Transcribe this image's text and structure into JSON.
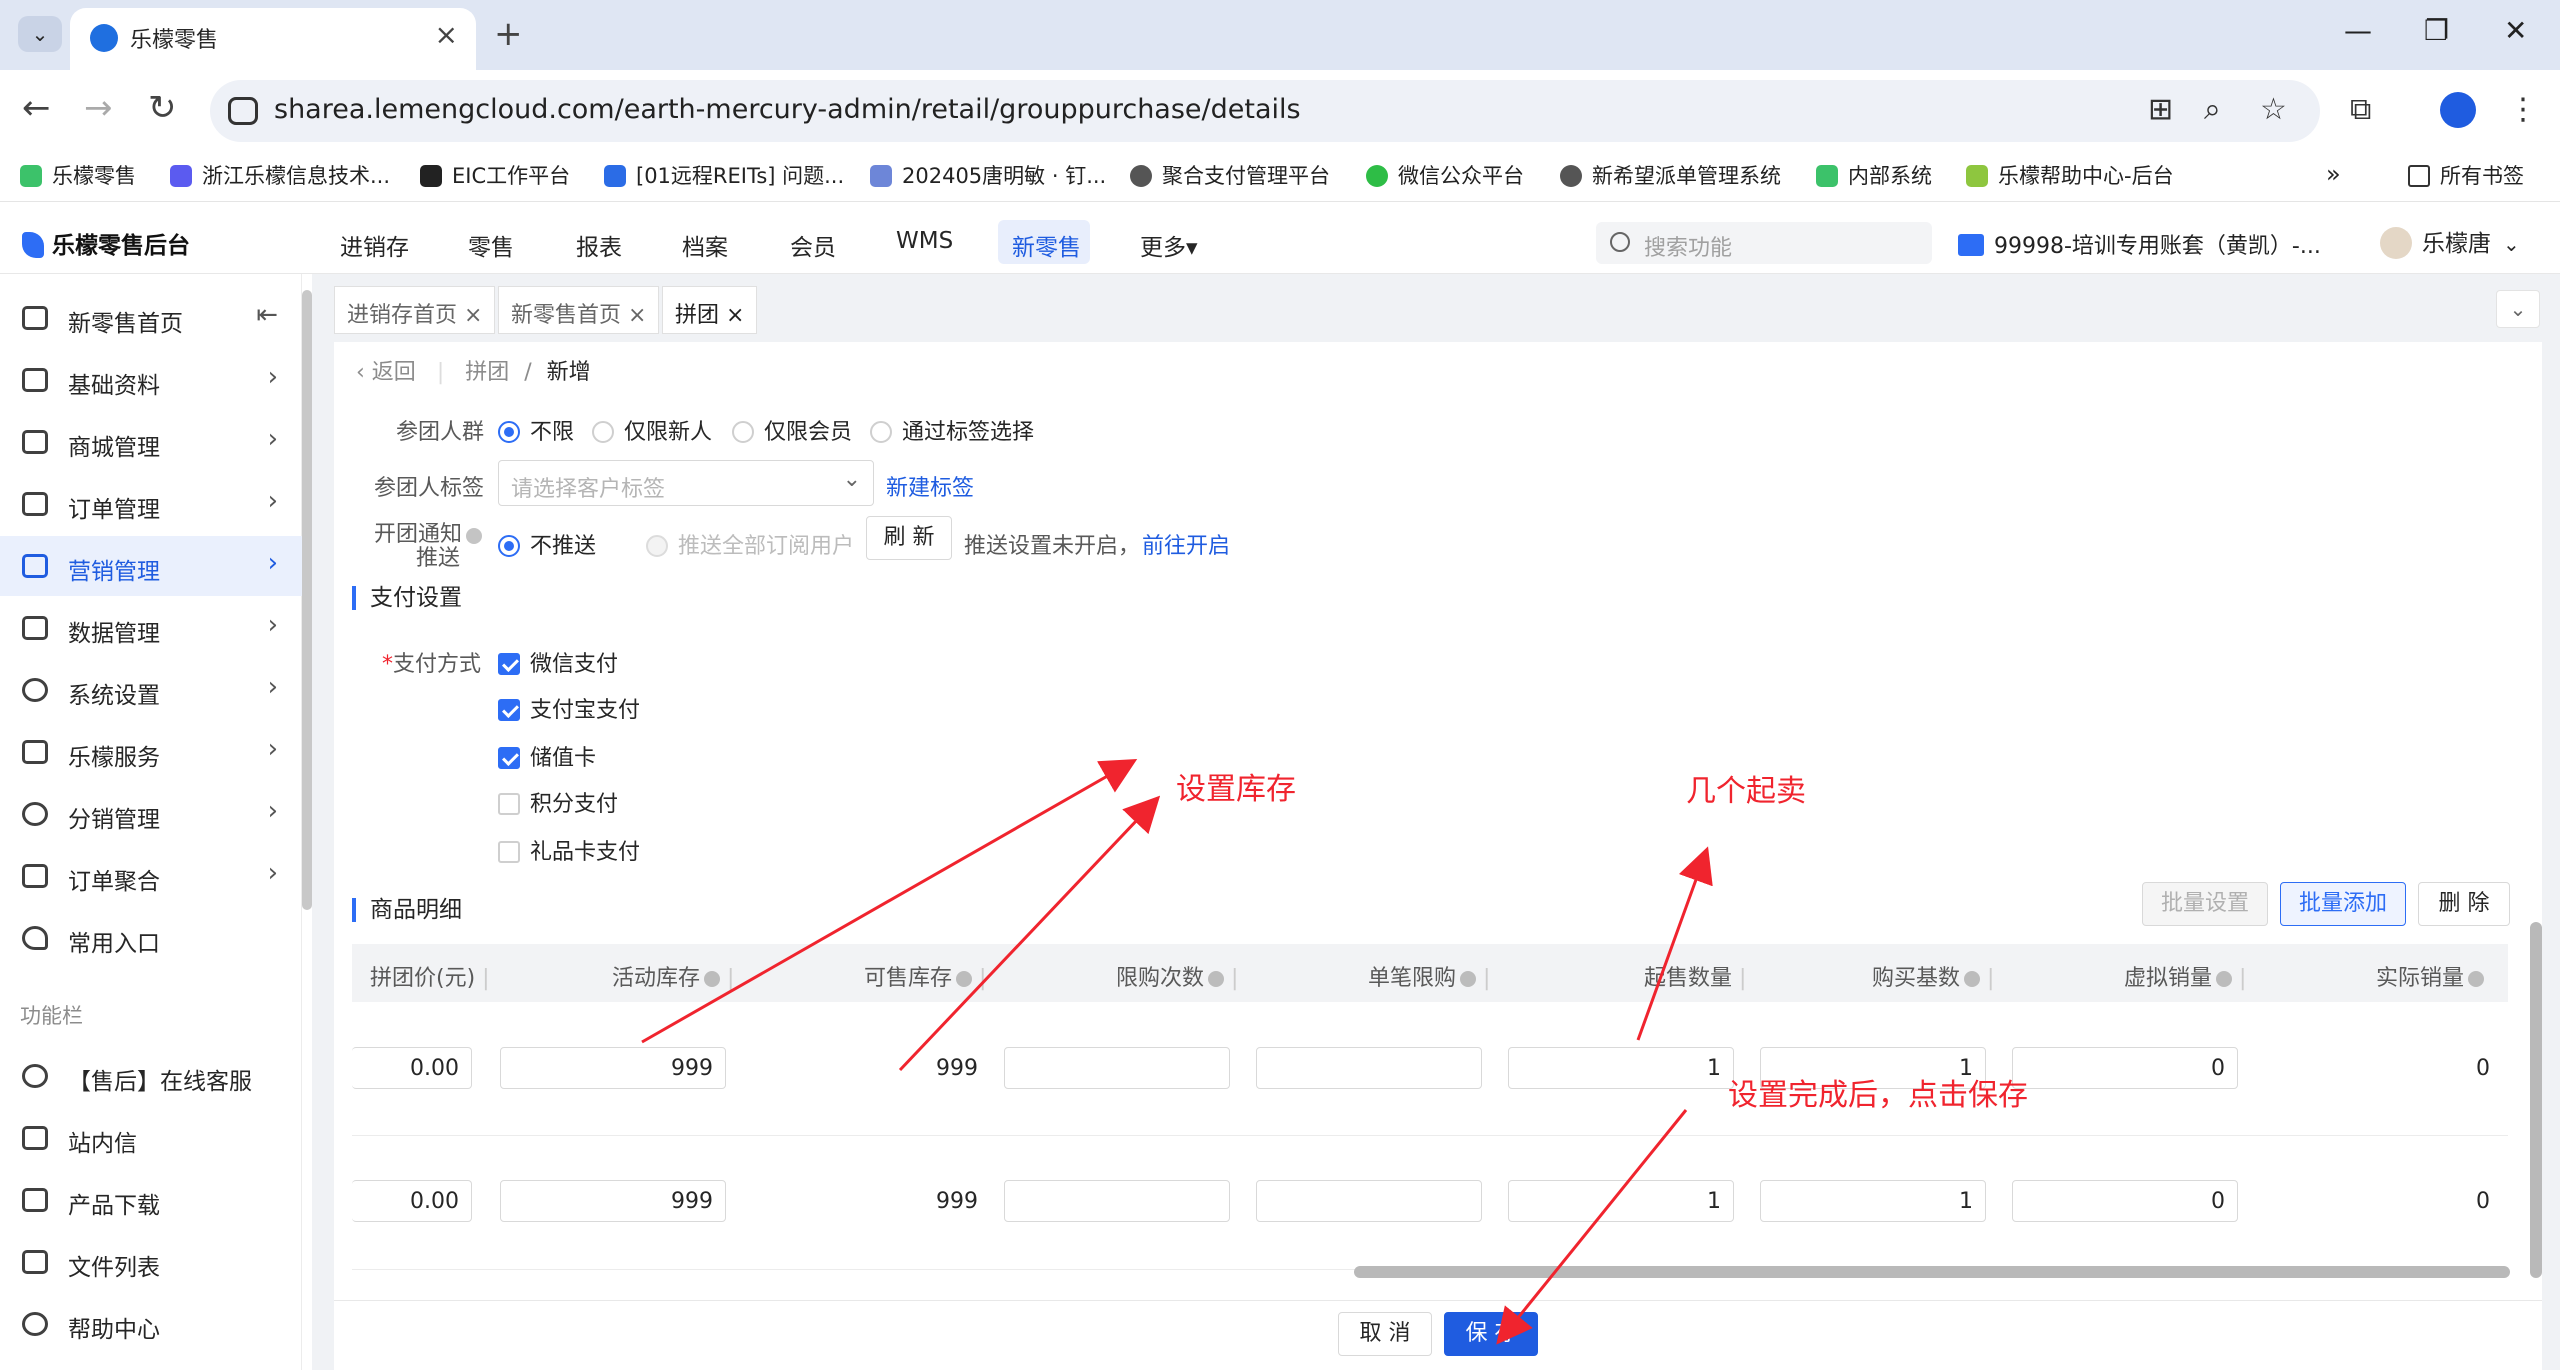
{
  "browser": {
    "tab_title": "乐檬零售",
    "new_tab": "+",
    "url": "sharea.lemengcloud.com/earth-mercury-admin/retail/grouppurchase/details",
    "bookmarks": [
      "乐檬零售",
      "浙江乐檬信息技术...",
      "EIC工作平台",
      "[01远程REITs] 问题...",
      "202405唐明敏 · 钉...",
      "聚合支付管理平台",
      "微信公众平台",
      "新希望派单管理系统",
      "内部系统",
      "乐檬帮助中心-后台"
    ],
    "bookmarks_more": "»",
    "all_bookmarks": "所有书签"
  },
  "app": {
    "logo": "乐檬零售后台",
    "top_menu": [
      "进销存",
      "零售",
      "报表",
      "档案",
      "会员",
      "WMS",
      "新零售",
      "更多▾"
    ],
    "active_menu": "新零售",
    "search_placeholder": "搜索功能",
    "account": "99998-培训专用账套（黄凯）-...",
    "user": "乐檬唐"
  },
  "sidebar": {
    "items": [
      {
        "label": "新零售首页",
        "icon": "home-icon"
      },
      {
        "label": "基础资料",
        "icon": "grid-icon"
      },
      {
        "label": "商城管理",
        "icon": "store-icon"
      },
      {
        "label": "订单管理",
        "icon": "order-icon"
      },
      {
        "label": "营销管理",
        "icon": "marketing-icon"
      },
      {
        "label": "数据管理",
        "icon": "chart-icon"
      },
      {
        "label": "系统设置",
        "icon": "settings-icon"
      },
      {
        "label": "乐檬服务",
        "icon": "service-icon"
      },
      {
        "label": "分销管理",
        "icon": "distribution-icon"
      },
      {
        "label": "订单聚合",
        "icon": "aggregate-icon"
      },
      {
        "label": "常用入口",
        "icon": "heart-icon"
      }
    ],
    "section_label": "功能栏",
    "func_items": [
      {
        "label": "【售后】在线客服",
        "icon": "headset-icon"
      },
      {
        "label": "站内信",
        "icon": "mail-icon"
      },
      {
        "label": "产品下载",
        "icon": "download-icon"
      },
      {
        "label": "文件列表",
        "icon": "file-list-icon"
      },
      {
        "label": "帮助中心",
        "icon": "help-icon"
      }
    ]
  },
  "page_tabs": [
    {
      "label": "进销存首页",
      "close": "×"
    },
    {
      "label": "新零售首页",
      "close": "×"
    },
    {
      "label": "拼团",
      "close": "×"
    }
  ],
  "breadcrumb": {
    "back": "返回",
    "parent": "拼团",
    "sep": "/",
    "current": "新增"
  },
  "form": {
    "group_label": "参团人群",
    "group_options": [
      "不限",
      "仅限新人",
      "仅限会员",
      "通过标签选择"
    ],
    "tag_label": "参团人标签",
    "tag_placeholder": "请选择客户标签",
    "new_tag": "新建标签",
    "notify_label_1": "开团通知",
    "notify_label_2": "推送",
    "notify_options": [
      "不推送",
      "推送全部订阅用户"
    ],
    "refresh": "刷 新",
    "notify_tip": "推送设置未开启，",
    "notify_link": "前往开启"
  },
  "payment": {
    "section": "支付设置",
    "label": "支付方式",
    "required": "*",
    "methods": [
      {
        "label": "微信支付",
        "checked": true
      },
      {
        "label": "支付宝支付",
        "checked": true
      },
      {
        "label": "储值卡",
        "checked": true
      },
      {
        "label": "积分支付",
        "checked": false
      },
      {
        "label": "礼品卡支付",
        "checked": false
      }
    ]
  },
  "goods": {
    "section": "商品明细",
    "batch_set": "批量设置",
    "batch_add": "批量添加",
    "delete": "删 除",
    "columns": [
      "拼团价(元)",
      "活动库存",
      "可售库存",
      "限购次数",
      "单笔限购",
      "起售数量",
      "购买基数",
      "虚拟销量",
      "实际销量"
    ],
    "rows": [
      {
        "price": "0.00",
        "activity_stock": "999",
        "sellable_stock": "999",
        "limit_times": "",
        "per_order_limit": "",
        "min_qty": "1",
        "base_qty": "1",
        "virtual_sales": "0",
        "actual_sales": "0"
      },
      {
        "price": "0.00",
        "activity_stock": "999",
        "sellable_stock": "999",
        "limit_times": "",
        "per_order_limit": "",
        "min_qty": "1",
        "base_qty": "1",
        "virtual_sales": "0",
        "actual_sales": "0"
      }
    ]
  },
  "footer": {
    "cancel": "取 消",
    "save": "保 存"
  },
  "annotations": {
    "stock": "设置库存",
    "min_sale": "几个起卖",
    "save_tip": "设置完成后，点击保存"
  },
  "colors": {
    "accent": "#1f5ce0",
    "annotation": "#f0242e"
  }
}
